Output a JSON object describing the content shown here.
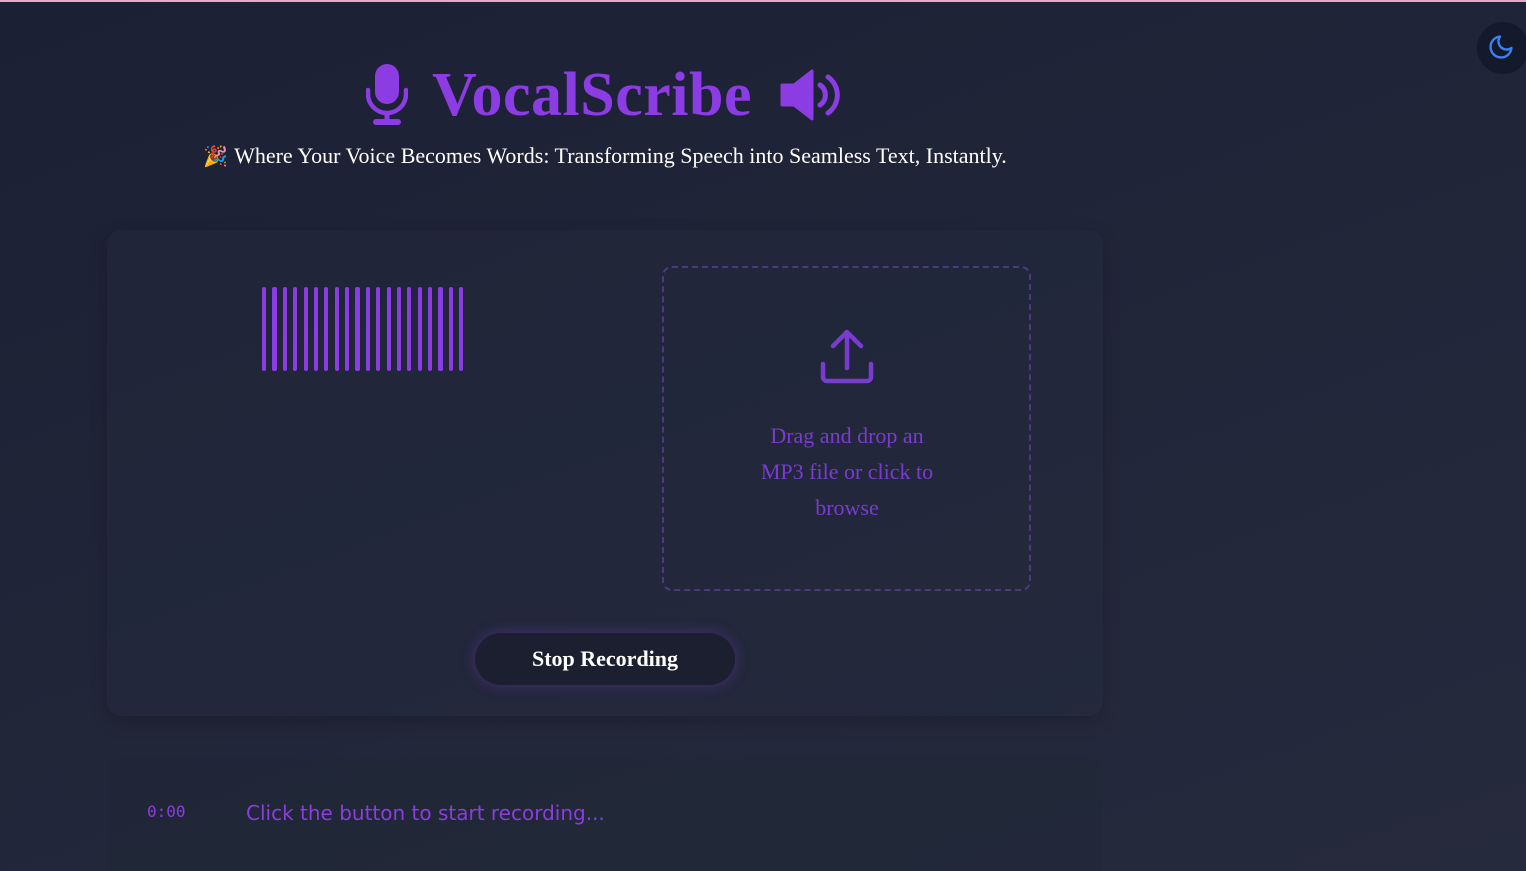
{
  "header": {
    "title": "VocalScribe",
    "subtitle_emoji": "🎉",
    "subtitle": "Where Your Voice Becomes Words: Transforming Speech into Seamless Text, Instantly."
  },
  "icons": {
    "title_left": "microphone-icon",
    "title_right": "speaker-volume-icon",
    "theme_toggle": "moon-icon",
    "upload": "upload-icon"
  },
  "waveform": {
    "bar_count": 20
  },
  "dropzone": {
    "line1": "Drag and drop an",
    "line2": "MP3 file or click to",
    "line3": "browse"
  },
  "controls": {
    "stop_label": "Stop Recording"
  },
  "status": {
    "timer": "0:00",
    "message": "Click the button to start recording..."
  },
  "colors": {
    "accent": "#8b3ce2",
    "background": "#1f2336",
    "toggle_icon": "#3b82f6"
  }
}
